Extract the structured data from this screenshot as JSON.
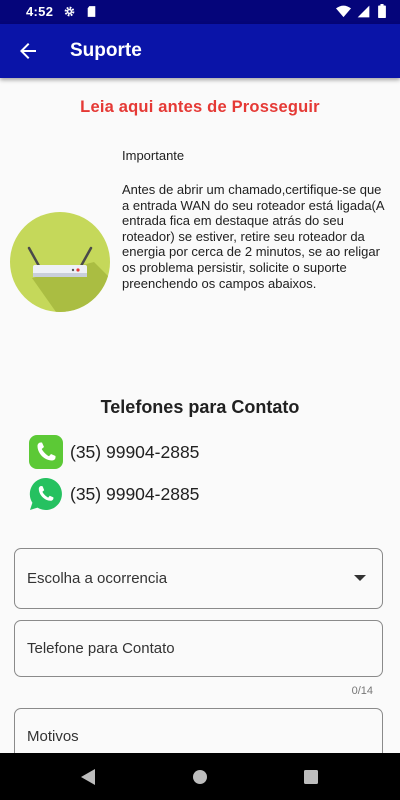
{
  "status_bar": {
    "time": "4:52",
    "left_icons": [
      "gear-icon",
      "sd-card-icon"
    ],
    "right_icons": [
      "wifi-icon",
      "signal-icon",
      "battery-icon"
    ]
  },
  "app_bar": {
    "title": "Suporte",
    "background": "#0a14a8"
  },
  "notice": {
    "title": "Leia aqui antes de Prosseguir",
    "title_color": "#e53935",
    "heading": "Importante",
    "body": "Antes de abrir um chamado,certifique-se que a entrada WAN do seu roteador está ligada(A entrada fica em destaque atrás do seu roteador) se estiver, retire seu roteador da energia por cerca de 2 minutos, se ao religar os problema persistir, solicite o suporte preenchendo os campos abaixos."
  },
  "contacts": {
    "title": "Telefones para Contato",
    "phones": [
      {
        "icon": "phone-icon",
        "number": "(35) 99904-2885"
      },
      {
        "icon": "whatsapp-icon",
        "number": "(35) 99904-2885"
      }
    ]
  },
  "form": {
    "occurrence_label": "Escolha a ocorrencia",
    "phone_label": "Telefone para Contato",
    "phone_counter": "0/14",
    "reasons_label": "Motivos"
  },
  "nav_bar": {
    "icons": [
      "back-triangle-icon",
      "home-circle-icon",
      "recents-square-icon"
    ]
  }
}
